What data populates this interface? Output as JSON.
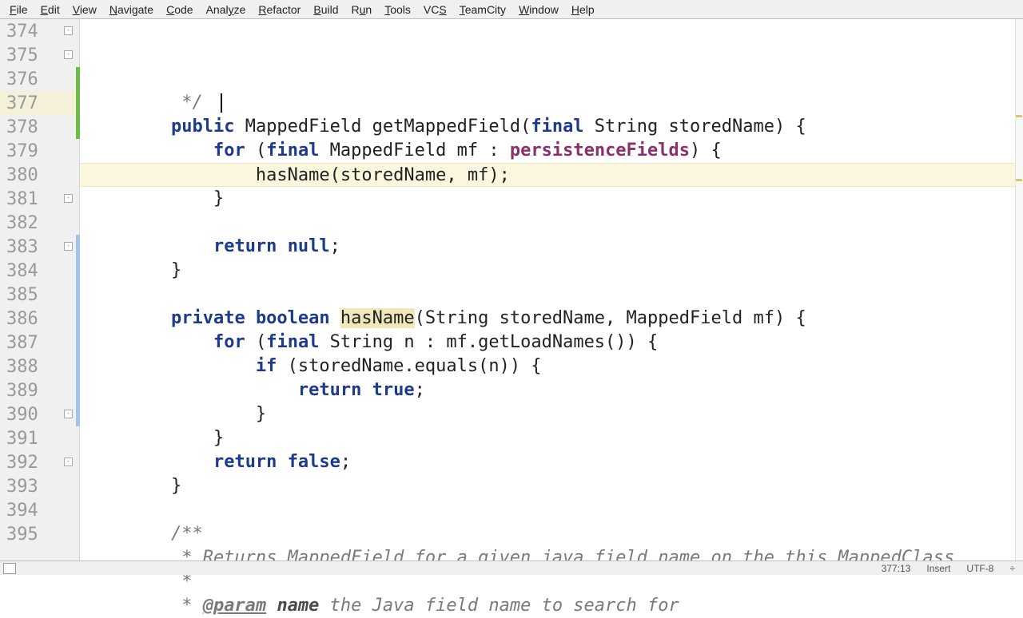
{
  "menu": {
    "items": [
      {
        "label": "File",
        "u": 0
      },
      {
        "label": "Edit",
        "u": 0
      },
      {
        "label": "View",
        "u": 0
      },
      {
        "label": "Navigate",
        "u": 0
      },
      {
        "label": "Code",
        "u": 0
      },
      {
        "label": "Analyze",
        "u": 4
      },
      {
        "label": "Refactor",
        "u": 0
      },
      {
        "label": "Build",
        "u": 0
      },
      {
        "label": "Run",
        "u": 1
      },
      {
        "label": "Tools",
        "u": 0
      },
      {
        "label": "VCS",
        "u": 2
      },
      {
        "label": "TeamCity",
        "u": 0
      },
      {
        "label": "Window",
        "u": 0
      },
      {
        "label": "Help",
        "u": 0
      }
    ]
  },
  "editor": {
    "first_line_number": 374,
    "current_line": 377,
    "lines": [
      {
        "no": 374,
        "tokens": [
          [
            "         */",
            "comment"
          ]
        ],
        "fold": "-"
      },
      {
        "no": 375,
        "tokens": [
          [
            "        ",
            ""
          ],
          [
            "public",
            "kw"
          ],
          [
            " MappedField getMappedField(",
            ""
          ],
          [
            "final",
            "kw"
          ],
          [
            " String storedName) {",
            ""
          ]
        ],
        "fold": "-"
      },
      {
        "no": 376,
        "tokens": [
          [
            "            ",
            ""
          ],
          [
            "for",
            "kw"
          ],
          [
            " (",
            ""
          ],
          [
            "final",
            "kw"
          ],
          [
            " MappedField mf : ",
            ""
          ],
          [
            "persistenceFields",
            "field"
          ],
          [
            ") {",
            ""
          ]
        ],
        "vcs": "green"
      },
      {
        "no": 377,
        "tokens": [
          [
            "                ",
            ""
          ],
          [
            "hasName",
            "call"
          ],
          [
            "(storedName, mf);",
            ""
          ]
        ],
        "vcs": "green",
        "current": true
      },
      {
        "no": 378,
        "tokens": [
          [
            "            }",
            ""
          ]
        ],
        "vcs": "green"
      },
      {
        "no": 379,
        "tokens": [
          [
            "",
            ""
          ]
        ]
      },
      {
        "no": 380,
        "tokens": [
          [
            "            ",
            ""
          ],
          [
            "return",
            "kw"
          ],
          [
            " ",
            ""
          ],
          [
            "null",
            "kw"
          ],
          [
            ";",
            ""
          ]
        ]
      },
      {
        "no": 381,
        "tokens": [
          [
            "        }",
            ""
          ]
        ],
        "fold": "-"
      },
      {
        "no": 382,
        "tokens": [
          [
            "",
            ""
          ]
        ]
      },
      {
        "no": 383,
        "tokens": [
          [
            "        ",
            ""
          ],
          [
            "private",
            "kw"
          ],
          [
            " ",
            ""
          ],
          [
            "boolean",
            "kw"
          ],
          [
            " ",
            ""
          ],
          [
            "hasName",
            "hl-yellow"
          ],
          [
            "(String storedName, MappedField mf) {",
            ""
          ]
        ],
        "fold": "-",
        "vcs": "blue"
      },
      {
        "no": 384,
        "tokens": [
          [
            "            ",
            ""
          ],
          [
            "for",
            "kw"
          ],
          [
            " (",
            ""
          ],
          [
            "final",
            "kw"
          ],
          [
            " String n : mf.getLoadNames()) {",
            ""
          ]
        ],
        "vcs": "blue"
      },
      {
        "no": 385,
        "tokens": [
          [
            "                ",
            ""
          ],
          [
            "if",
            "kw"
          ],
          [
            " (storedName.equals(n)) {",
            ""
          ]
        ],
        "vcs": "blue"
      },
      {
        "no": 386,
        "tokens": [
          [
            "                    ",
            ""
          ],
          [
            "return",
            "kw"
          ],
          [
            " ",
            ""
          ],
          [
            "true",
            "kw"
          ],
          [
            ";",
            ""
          ]
        ],
        "vcs": "blue"
      },
      {
        "no": 387,
        "tokens": [
          [
            "                }",
            ""
          ]
        ],
        "vcs": "blue"
      },
      {
        "no": 388,
        "tokens": [
          [
            "            }",
            ""
          ]
        ],
        "vcs": "blue"
      },
      {
        "no": 389,
        "tokens": [
          [
            "            ",
            ""
          ],
          [
            "return",
            "kw"
          ],
          [
            " ",
            ""
          ],
          [
            "false",
            "kw"
          ],
          [
            ";",
            ""
          ]
        ],
        "vcs": "blue"
      },
      {
        "no": 390,
        "tokens": [
          [
            "        }",
            ""
          ]
        ],
        "fold": "-",
        "vcs": "blue"
      },
      {
        "no": 391,
        "tokens": [
          [
            "",
            ""
          ]
        ]
      },
      {
        "no": 392,
        "tokens": [
          [
            "        ",
            ""
          ],
          [
            "/**",
            "comment"
          ]
        ],
        "fold": "-"
      },
      {
        "no": 393,
        "tokens": [
          [
            "         * Returns MappedField for a given java field name on the this MappedClass",
            "comment"
          ]
        ]
      },
      {
        "no": 394,
        "tokens": [
          [
            "         *",
            "comment"
          ]
        ]
      },
      {
        "no": 395,
        "tokens": [
          [
            "         * ",
            "comment"
          ],
          [
            "@param",
            "doc-tag"
          ],
          [
            " ",
            "comment"
          ],
          [
            "name",
            "doc-param"
          ],
          [
            " the Java field name to search for",
            "comment"
          ]
        ]
      }
    ]
  },
  "status": {
    "pos": "377:13",
    "insert": "Insert",
    "encoding": "UTF-8",
    "sep": "÷"
  }
}
